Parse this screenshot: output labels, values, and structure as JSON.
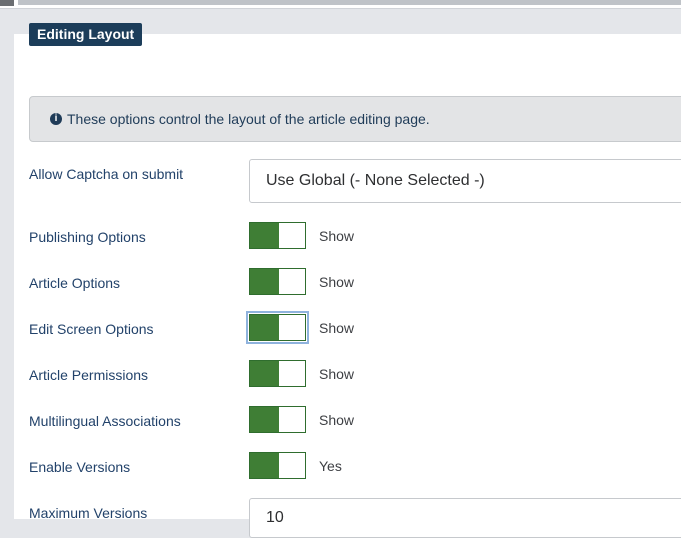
{
  "fieldset": {
    "legend": "Editing Layout",
    "info": "These options control the layout of the article editing page."
  },
  "fields": {
    "captcha": {
      "label": "Allow Captcha on submit",
      "value": "Use Global (- None Selected -)"
    },
    "publishing": {
      "label": "Publishing Options",
      "value": "Show"
    },
    "article_options": {
      "label": "Article Options",
      "value": "Show"
    },
    "edit_screen": {
      "label": "Edit Screen Options",
      "value": "Show"
    },
    "permissions": {
      "label": "Article Permissions",
      "value": "Show"
    },
    "multilingual": {
      "label": "Multilingual Associations",
      "value": "Show"
    },
    "versions": {
      "label": "Enable Versions",
      "value": "Yes"
    },
    "max_versions": {
      "label": "Maximum Versions",
      "value": "10"
    }
  },
  "colors": {
    "legend_bg": "#1c3d5a",
    "switch_on": "#3f7e35",
    "label_text": "#22426a"
  }
}
